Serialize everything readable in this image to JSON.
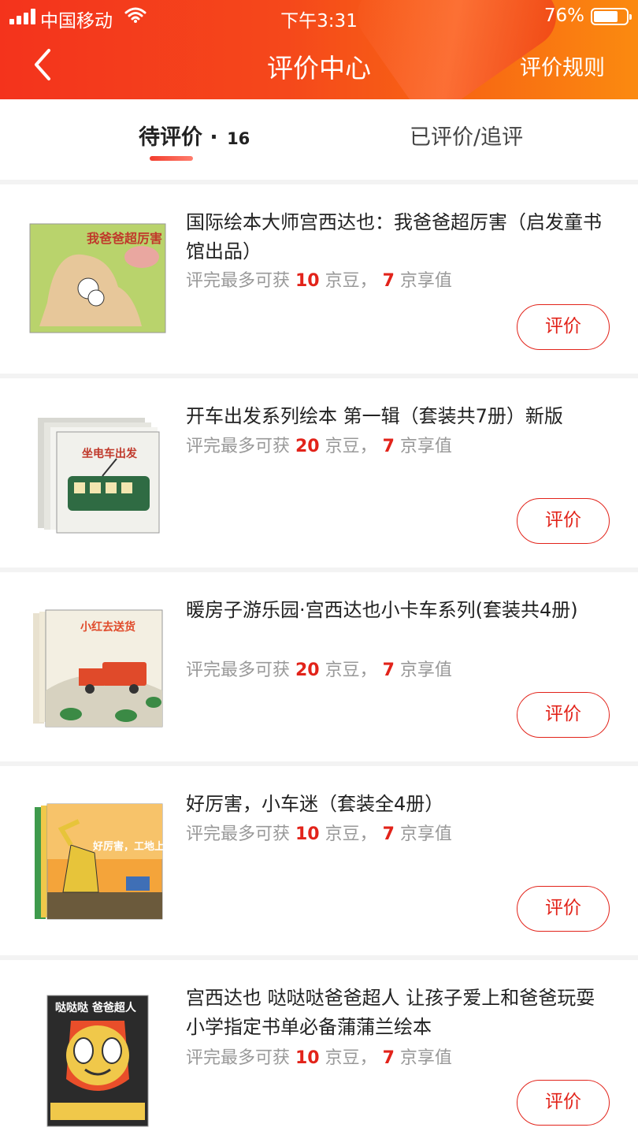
{
  "status_bar": {
    "carrier": "中国移动",
    "time": "下午3:31",
    "battery_percent": "76%",
    "battery_level": 0.76
  },
  "header": {
    "title": "评价中心",
    "rules_label": "评价规则"
  },
  "tabs": [
    {
      "label": "待评价 · ",
      "count": "16",
      "active": true
    },
    {
      "label": "已评价/追评",
      "active": false
    }
  ],
  "reward_text": {
    "prefix": "评完最多可获 ",
    "unit_bean": " 京豆，",
    "unit_value": " 京享值"
  },
  "items": [
    {
      "name": "国际绘本大师宫西达也：我爸爸超厉害（启发童书馆出品）",
      "beans": "10",
      "value": "7",
      "button": "评价"
    },
    {
      "name": "开车出发系列绘本 第一辑（套装共7册）新版",
      "beans": "20",
      "value": "7",
      "button": "评价"
    },
    {
      "name": "暖房子游乐园·宫西达也小卡车系列(套装共4册)",
      "beans": "20",
      "value": "7",
      "button": "评价"
    },
    {
      "name": "好厉害，小车迷（套装全4册）",
      "beans": "10",
      "value": "7",
      "button": "评价"
    },
    {
      "name": "宫西达也 哒哒哒爸爸超人 让孩子爱上和爸爸玩耍 小学指定书单必备蒲蒲兰绘本",
      "beans": "10",
      "value": "7",
      "button": "评价"
    }
  ],
  "covers": [
    {
      "title": "我爸爸超厉害",
      "colors": [
        "#b9d36c",
        "#e7c79a",
        "#c0392b"
      ]
    },
    {
      "title": "坐电车出发",
      "colors": [
        "#f1f1ec",
        "#2f6b43",
        "#c0392b"
      ]
    },
    {
      "title": "小红去送货",
      "colors": [
        "#f3efe2",
        "#e04a2a",
        "#3b8a45"
      ]
    },
    {
      "title": "好厉害，工地上的车",
      "colors": [
        "#f4a43a",
        "#3f6fb6",
        "#e7c43a"
      ]
    },
    {
      "title": "哒哒哒 爸爸超人",
      "colors": [
        "#2b2b2b",
        "#e94e2a",
        "#f0c84a"
      ]
    }
  ]
}
